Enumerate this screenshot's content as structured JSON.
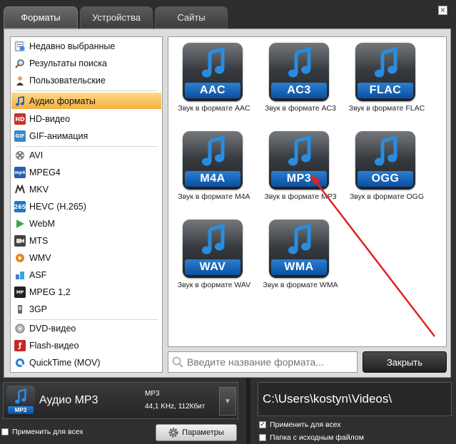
{
  "tabs": [
    {
      "label": "Форматы",
      "active": true
    },
    {
      "label": "Устройства",
      "active": false
    },
    {
      "label": "Сайты",
      "active": false
    }
  ],
  "window": {
    "close_glyph": "×"
  },
  "sidebar": {
    "items": [
      {
        "label": "Недавно выбранные",
        "icon": "recent-icon"
      },
      {
        "label": "Результаты поиска",
        "icon": "search-icon"
      },
      {
        "label": "Пользовательские",
        "icon": "user-icon"
      },
      {
        "label": "Аудио форматы",
        "icon": "music-note-icon",
        "active": true
      },
      {
        "label": "HD-видео",
        "icon": "hd-icon"
      },
      {
        "label": "GIF-анимация",
        "icon": "gif-icon"
      },
      {
        "label": "AVI",
        "icon": "film-reel-icon"
      },
      {
        "label": "MPEG4",
        "icon": "mpeg4-icon"
      },
      {
        "label": "MKV",
        "icon": "mkv-icon"
      },
      {
        "label": "HEVC (H.265)",
        "icon": "hevc-icon"
      },
      {
        "label": "WebM",
        "icon": "webm-play-icon"
      },
      {
        "label": "MTS",
        "icon": "mts-icon"
      },
      {
        "label": "WMV",
        "icon": "wmv-icon"
      },
      {
        "label": "ASF",
        "icon": "asf-icon"
      },
      {
        "label": "MPEG 1,2",
        "icon": "mpeg12-icon"
      },
      {
        "label": "3GP",
        "icon": "phone-icon"
      },
      {
        "label": "DVD-видео",
        "icon": "dvd-icon"
      },
      {
        "label": "Flash-видео",
        "icon": "flash-icon"
      },
      {
        "label": "QuickTime (MOV)",
        "icon": "quicktime-icon"
      }
    ]
  },
  "formats": [
    {
      "badge": "AAC",
      "caption": "Звук в формате AAC"
    },
    {
      "badge": "AC3",
      "caption": "Звук в формате AC3"
    },
    {
      "badge": "FLAC",
      "caption": "Звук в формате FLAC"
    },
    {
      "badge": "M4A",
      "caption": "Звук в формате M4A"
    },
    {
      "badge": "MP3",
      "caption": "Звук в формате MP3"
    },
    {
      "badge": "OGG",
      "caption": "Звук в формате OGG"
    },
    {
      "badge": "WAV",
      "caption": "Звук в формате WAV"
    },
    {
      "badge": "WMA",
      "caption": "Звук в формате WMA"
    }
  ],
  "search": {
    "placeholder": "Введите название формата..."
  },
  "close_button": "Закрыть",
  "output_format": {
    "icon_badge": "MP3",
    "name": "Аудио MP3",
    "details_line1": "MP3",
    "details_line2": "44,1 KHz, 112Кбит",
    "dropdown_glyph": "▼"
  },
  "apply_all_left": {
    "label": "Применить для всех",
    "checked": false
  },
  "params_button": "Параметры",
  "output_path": "C:\\Users\\kostyn\\Videos\\",
  "apply_all_right": {
    "label": "Применить для всех",
    "checked": true,
    "mark": "✓"
  },
  "source_folder": {
    "label": "Папка с исходным файлом",
    "checked": false
  },
  "colors": {
    "accent_blue": "#1a63b8",
    "active_item": "#f5b040",
    "arrow": "#e52020"
  }
}
